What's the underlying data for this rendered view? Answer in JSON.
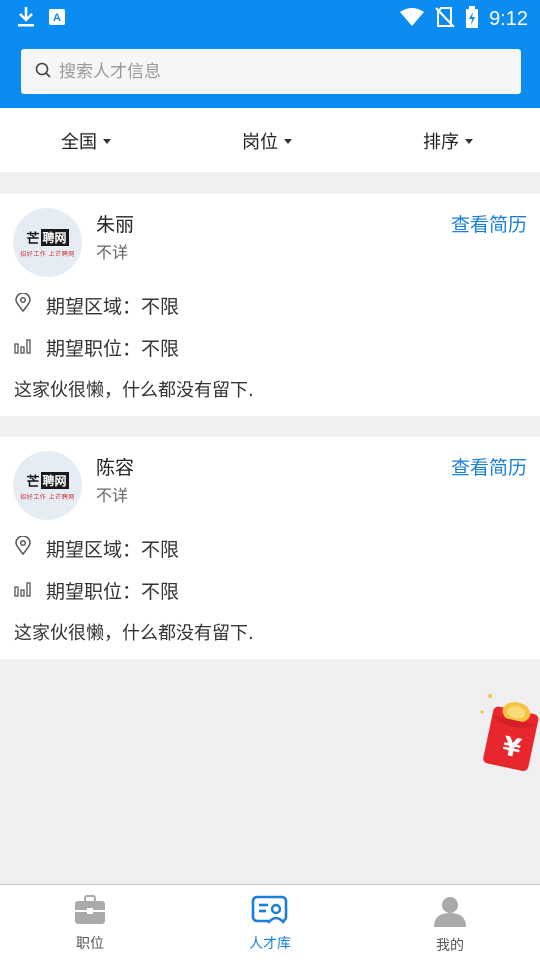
{
  "status_bar": {
    "time": "9:12"
  },
  "search": {
    "placeholder": "搜索人才信息",
    "value": ""
  },
  "filters": {
    "region": "全国",
    "position": "岗位",
    "sort": "排序"
  },
  "talents": [
    {
      "name": "朱丽",
      "info": "不详",
      "resume_link": "查看简历",
      "region_label": "期望区域：",
      "region_value": "不限",
      "position_label": "期望职位：",
      "position_value": "不限",
      "intro": "这家伙很懒，什么都没有留下."
    },
    {
      "name": "陈容",
      "info": "不详",
      "resume_link": "查看简历",
      "region_label": "期望区域：",
      "region_value": "不限",
      "position_label": "期望职位：",
      "position_value": "不限",
      "intro": "这家伙很懒，什么都没有留下."
    }
  ],
  "avatar_logo": {
    "main": "芒",
    "box": "聘网",
    "sub": "招好工作 上芒聘网"
  },
  "red_packet": {
    "symbol": "¥"
  },
  "bottom_nav": {
    "jobs": "职位",
    "talent_pool": "人才库",
    "mine": "我的",
    "active": "talent_pool"
  },
  "colors": {
    "primary": "#0a8cf2",
    "link": "#1a7fdb",
    "red_packet": "#e8262d"
  },
  "icons": [
    "download-icon",
    "keyboard-icon",
    "wifi-icon",
    "no-sim-icon",
    "battery-charging-icon",
    "search-icon",
    "location-pin-icon",
    "bar-chart-icon",
    "briefcase-icon",
    "talent-card-icon",
    "person-icon",
    "red-packet-icon"
  ]
}
